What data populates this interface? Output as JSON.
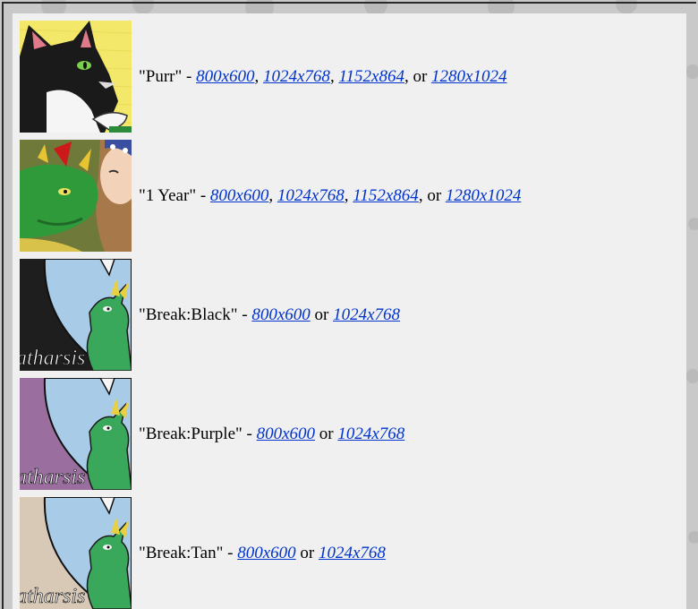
{
  "wallpapers": [
    {
      "title": "\"Purr\"",
      "thumb_icon": "black-cat-thumbnail-icon",
      "links": [
        "800x600",
        "1024x768",
        "1152x864",
        "1280x1024"
      ],
      "seps": [
        ", ",
        ", ",
        ", or "
      ]
    },
    {
      "title": "\"1 Year\"",
      "thumb_icon": "green-dragon-thumbnail-icon",
      "links": [
        "800x600",
        "1024x768",
        "1152x864",
        "1280x1024"
      ],
      "seps": [
        ", ",
        ", ",
        ", or "
      ]
    },
    {
      "title": "\"Break:Black\"",
      "thumb_icon": "dragon-speech-bubble-black-thumbnail-icon",
      "links": [
        "800x600",
        "1024x768"
      ],
      "seps": [
        " or "
      ],
      "thumb_text": "atharsis"
    },
    {
      "title": "\"Break:Purple\"",
      "thumb_icon": "dragon-speech-bubble-purple-thumbnail-icon",
      "links": [
        "800x600",
        "1024x768"
      ],
      "seps": [
        " or "
      ],
      "thumb_text": "atharsis"
    },
    {
      "title": "\"Break:Tan\"",
      "thumb_icon": "dragon-speech-bubble-tan-thumbnail-icon",
      "links": [
        "800x600",
        "1024x768"
      ],
      "seps": [
        " or "
      ],
      "thumb_text": "atharsis"
    }
  ],
  "dash": " - ",
  "colors": {
    "link": "#0033cc",
    "panel": "#f0f0f0",
    "background": "#c9c9c9",
    "break_black": "#1e1e1e",
    "break_purple": "#9a6fa0",
    "break_tan": "#d8c8b6"
  }
}
